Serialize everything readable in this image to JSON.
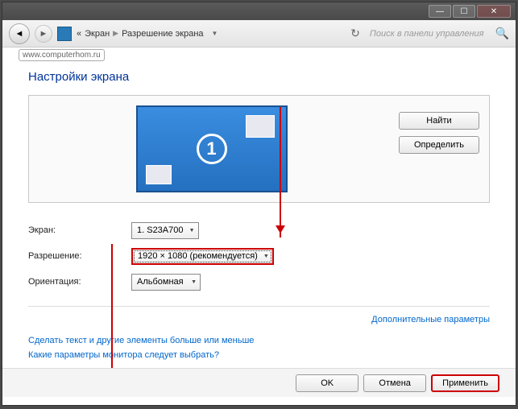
{
  "titlebar": {
    "min": "—",
    "max": "☐",
    "close": "✕"
  },
  "nav": {
    "back": "◄",
    "fwd": "►",
    "bc_root": "«",
    "bc_screen": "Экран",
    "bc_res": "Разрешение экрана",
    "refresh": "↻",
    "search_placeholder": "Поиск в панели управления",
    "search_icon": "🔍"
  },
  "watermark": "www.computerhom.ru",
  "page_title": "Настройки экрана",
  "monitor_number": "1",
  "buttons": {
    "find": "Найти",
    "detect": "Определить"
  },
  "form": {
    "display_label": "Экран:",
    "display_value": "1. S23A700",
    "resolution_label": "Разрешение:",
    "resolution_value": "1920 × 1080 (рекомендуется)",
    "orientation_label": "Ориентация:",
    "orientation_value": "Альбомная"
  },
  "links": {
    "advanced": "Дополнительные параметры",
    "text_size": "Сделать текст и другие элементы больше или меньше",
    "which_monitor": "Какие параметры монитора следует выбрать?"
  },
  "footer": {
    "ok": "OK",
    "cancel": "Отмена",
    "apply": "Применить"
  }
}
